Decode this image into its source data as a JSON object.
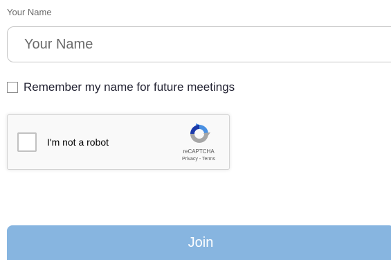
{
  "form": {
    "name_label": "Your Name",
    "name_value": "",
    "name_placeholder": "Your Name",
    "remember_label": "Remember my name for future meetings",
    "remember_checked": false,
    "join_label": "Join"
  },
  "recaptcha": {
    "label": "I'm not a robot",
    "brand": "reCAPTCHA",
    "privacy_link": "Privacy",
    "separator": " - ",
    "terms_link": "Terms",
    "icon": "recaptcha-logo-icon"
  },
  "colors": {
    "join_button": "#87b5e0",
    "recaptcha_blue": "#4a90e2",
    "recaptcha_gray": "#a6a6a6"
  }
}
